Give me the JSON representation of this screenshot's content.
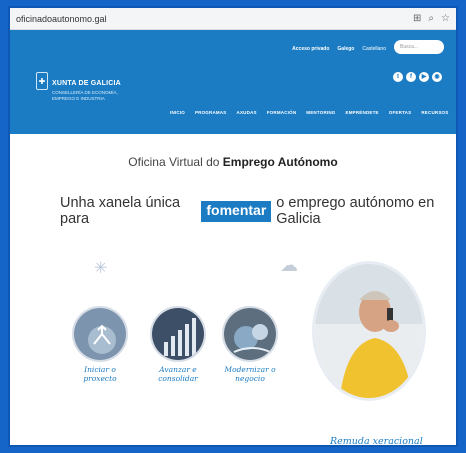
{
  "browser": {
    "url": "oficinadoautonomo.gal"
  },
  "header": {
    "logo_title": "XUNTA DE GALICIA",
    "logo_sub1": "CONSELLERÍA DE ECONOMÍA,",
    "logo_sub2": "EMPREGO E INDUSTRIA",
    "access": "Acceso privado",
    "lang1": "Galego",
    "lang2": "Castellano",
    "search_placeholder": "Busca...",
    "nav": [
      "INICIO",
      "PROGRAMAS",
      "AXUDAS",
      "FORMACIÓN",
      "MENTORING",
      "EMPRÉNDETE",
      "OFERTAS",
      "RECURSOS"
    ]
  },
  "hero": {
    "title_light": "Oficina Virtual do ",
    "title_bold": "Emprego Autónomo",
    "tag_pre": "Unha xanela única para",
    "tag_highlight": "fomentar",
    "tag_post": "o emprego autónomo en Galicia"
  },
  "cards": [
    {
      "line1": "Iniciar o",
      "line2": "proxecto"
    },
    {
      "line1": "Avanzar e",
      "line2": "consolidar"
    },
    {
      "line1": "Modernizar o",
      "line2": "negocio"
    }
  ],
  "feature": {
    "label": "Remuda xeracional"
  },
  "colors": {
    "brand": "#1b7cc4",
    "page_bg": "#1565c8"
  }
}
